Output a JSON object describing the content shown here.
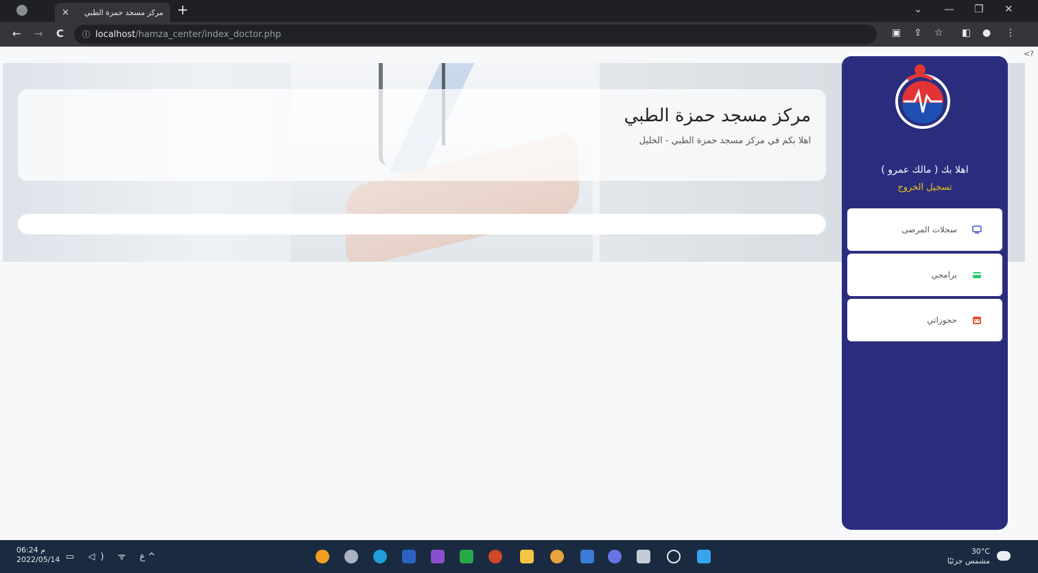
{
  "browser": {
    "tab_title": "مركز مسجد حمزة الطبي",
    "tab_close": "×",
    "new_tab": "+",
    "window_controls": [
      "⌄",
      "—",
      "❐",
      "✕"
    ],
    "back": "←",
    "forward": "→",
    "reload": "C",
    "url_info": "ⓘ",
    "url_host": "localhost",
    "url_path": "/hamza_center/index_doctor.php",
    "toolbar_icons": [
      "translate-icon",
      "share-icon",
      "star-icon",
      "sidepanel-icon",
      "profile-icon",
      "menu-icon"
    ]
  },
  "page": {
    "corner_text": "<?",
    "title": "مركز مسجد حمزة الطبي",
    "subtitle": "اهلا بكم في مركز مسجد حمزة الطبي - الخليل"
  },
  "sidebar": {
    "welcome": "اهلا بك ( مالك عمرو )",
    "logout": "تسجيل الخروج",
    "items": [
      {
        "label": "سجلات المرضى",
        "icon": "monitor-icon",
        "color": "#3a56c8"
      },
      {
        "label": "برامجي",
        "icon": "card-icon",
        "color": "#2ecc71"
      },
      {
        "label": "حجوزاتي",
        "icon": "calendar-icon",
        "color": "#e8552f"
      }
    ]
  },
  "taskbar": {
    "time": "06:24 م",
    "date": "2022/05/14",
    "tray": "▭ ◁) ᯤ ع ^",
    "temperature": "30°C",
    "weather": "مشمس جزئيًا",
    "apps": [
      {
        "icon": "vpn-icon",
        "color": "#f0a020"
      },
      {
        "icon": "network-icon",
        "color": "#aab4c0"
      },
      {
        "icon": "edge-icon",
        "color": "#1e9fd8"
      },
      {
        "icon": "word-icon",
        "color": "#2b62c4"
      },
      {
        "icon": "visual-studio-icon",
        "color": "#8a4fd0"
      },
      {
        "icon": "qc-icon",
        "color": "#27a844"
      },
      {
        "icon": "powerpoint-icon",
        "color": "#d24726"
      },
      {
        "icon": "folder-icon",
        "color": "#f6c445"
      },
      {
        "icon": "chrome-icon",
        "color": "#e8a33a"
      },
      {
        "icon": "store-icon",
        "color": "#3a7bd5"
      },
      {
        "icon": "chat-icon",
        "color": "#6674e8"
      },
      {
        "icon": "window-icon",
        "color": "#c4ccd6"
      },
      {
        "icon": "search-icon",
        "color": "#e8eaed"
      },
      {
        "icon": "start-icon",
        "color": "#38a4f0"
      }
    ]
  }
}
